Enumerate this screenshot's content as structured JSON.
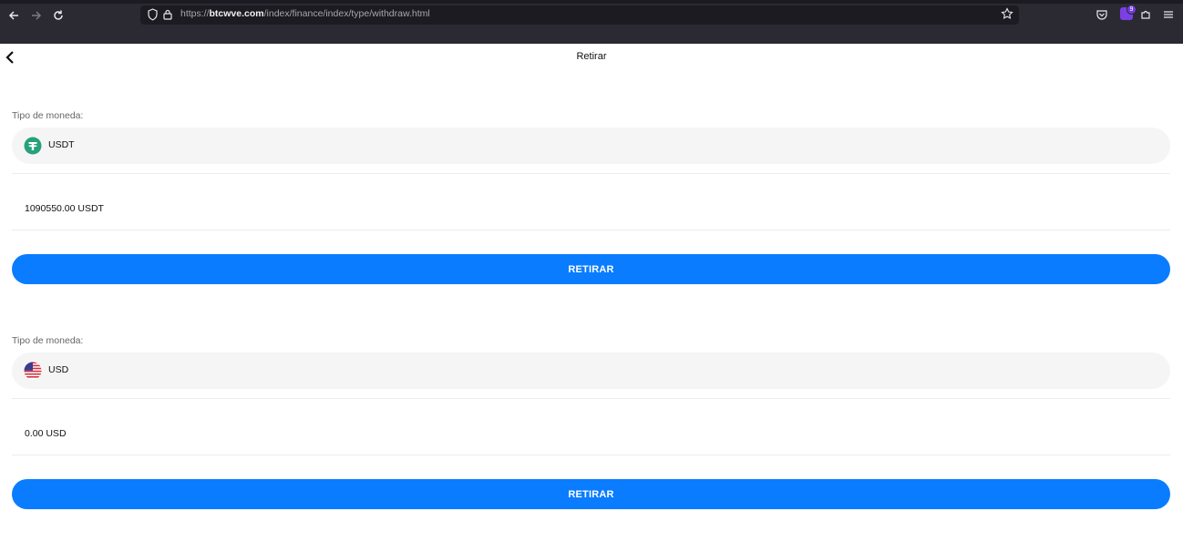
{
  "browser": {
    "url_prefix": "https://",
    "url_domain": "btcwve.com",
    "url_path": "/index/finance/index/type/withdraw.html",
    "extension_badge_count": "9",
    "icons": [
      "back-arrow-icon",
      "forward-arrow-icon",
      "reload-icon",
      "shield-icon",
      "lock-icon",
      "bookmark-star-icon",
      "pocket-icon",
      "extension-icon",
      "extensions-puzzle-icon",
      "menu-icon"
    ]
  },
  "page": {
    "title": "Retirar",
    "back_icon": "chevron-left-icon"
  },
  "sections": [
    {
      "label": "Tipo de moneda:",
      "currency": "USDT",
      "currency_icon": "tether-icon",
      "balance": "1090550.00 USDT",
      "button_label": "RETIRAR"
    },
    {
      "label": "Tipo de moneda:",
      "currency": "USD",
      "currency_icon": "us-flag-icon",
      "balance": "0.00 USD",
      "button_label": "RETIRAR"
    }
  ],
  "colors": {
    "accent": "#0a7cff",
    "tether": "#26a17b",
    "field_bg": "#f5f5f5",
    "browser_bg": "#2b2a33"
  }
}
